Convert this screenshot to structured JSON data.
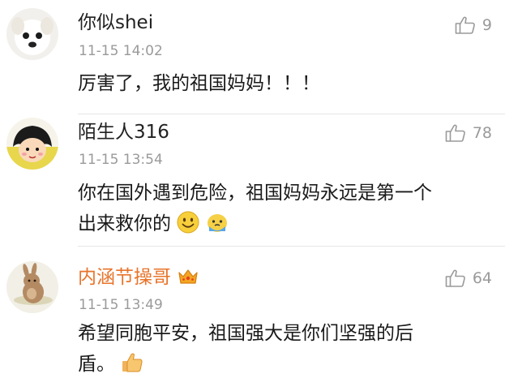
{
  "comments": [
    {
      "username": "你似shei",
      "time": "11-15 14:02",
      "likes": "9",
      "text": "厉害了，我的祖国妈妈！！！",
      "avatar": "puppy-avatar"
    },
    {
      "username": "陌生人316",
      "time": "11-15 13:54",
      "likes": "78",
      "text_line1": "你在国外遇到危险，祖国妈妈永远是第一个",
      "text_line2": "出来救你的",
      "avatar": "cartoon-girl-avatar",
      "emojis": [
        "smile-emoji",
        "crying-emoji"
      ]
    },
    {
      "username": "内涵节操哥",
      "time": "11-15 13:49",
      "likes": "64",
      "text_line1": "希望同胞平安，祖国强大是你们坚强的后",
      "text_line2": "盾。",
      "avatar": "rabbit-avatar",
      "badge": "crown-icon",
      "emojis": [
        "thumbs-up-emoji"
      ]
    }
  ],
  "colors": {
    "vip_name": "#e8742b",
    "muted": "#9a9a9a"
  }
}
